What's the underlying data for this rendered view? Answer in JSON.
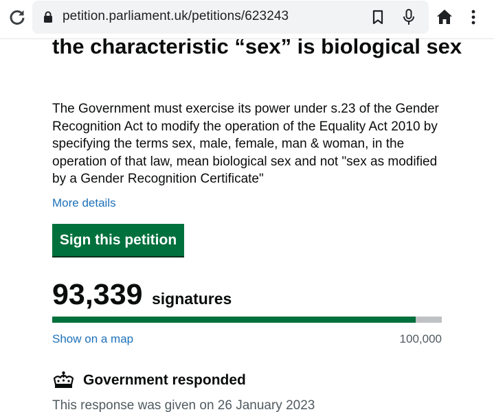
{
  "browser": {
    "url": "petition.parliament.uk/petitions/623243"
  },
  "petition": {
    "heading": "the characteristic “sex” is biological sex",
    "description": "The Government must exercise its power under s.23 of the Gender Recognition Act to modify the operation of the Equality Act 2010 by specifying the terms sex, male, female, man & woman, in the operation of that law, mean biological sex and not \"sex as modified by a Gender Recognition Certificate\"",
    "more_details_label": "More details",
    "sign_button_label": "Sign this petition"
  },
  "signatures": {
    "count": "93,339",
    "label": "signatures",
    "progress_fraction": 0.93339,
    "map_link_label": "Show on a map",
    "threshold": "100,000"
  },
  "government": {
    "heading": "Government responded",
    "response_note": "This response was given on 26 January 2023"
  },
  "colors": {
    "accent_green": "#00703c",
    "link_blue": "#1d70b8",
    "progress_track": "#bfc1c3"
  },
  "icons": {
    "reload": "reload-icon",
    "lock": "lock-icon",
    "bookmark": "bookmark-icon",
    "mic": "mic-icon",
    "home": "home-icon",
    "menu": "more-vert-icon",
    "crown": "crown-icon"
  }
}
